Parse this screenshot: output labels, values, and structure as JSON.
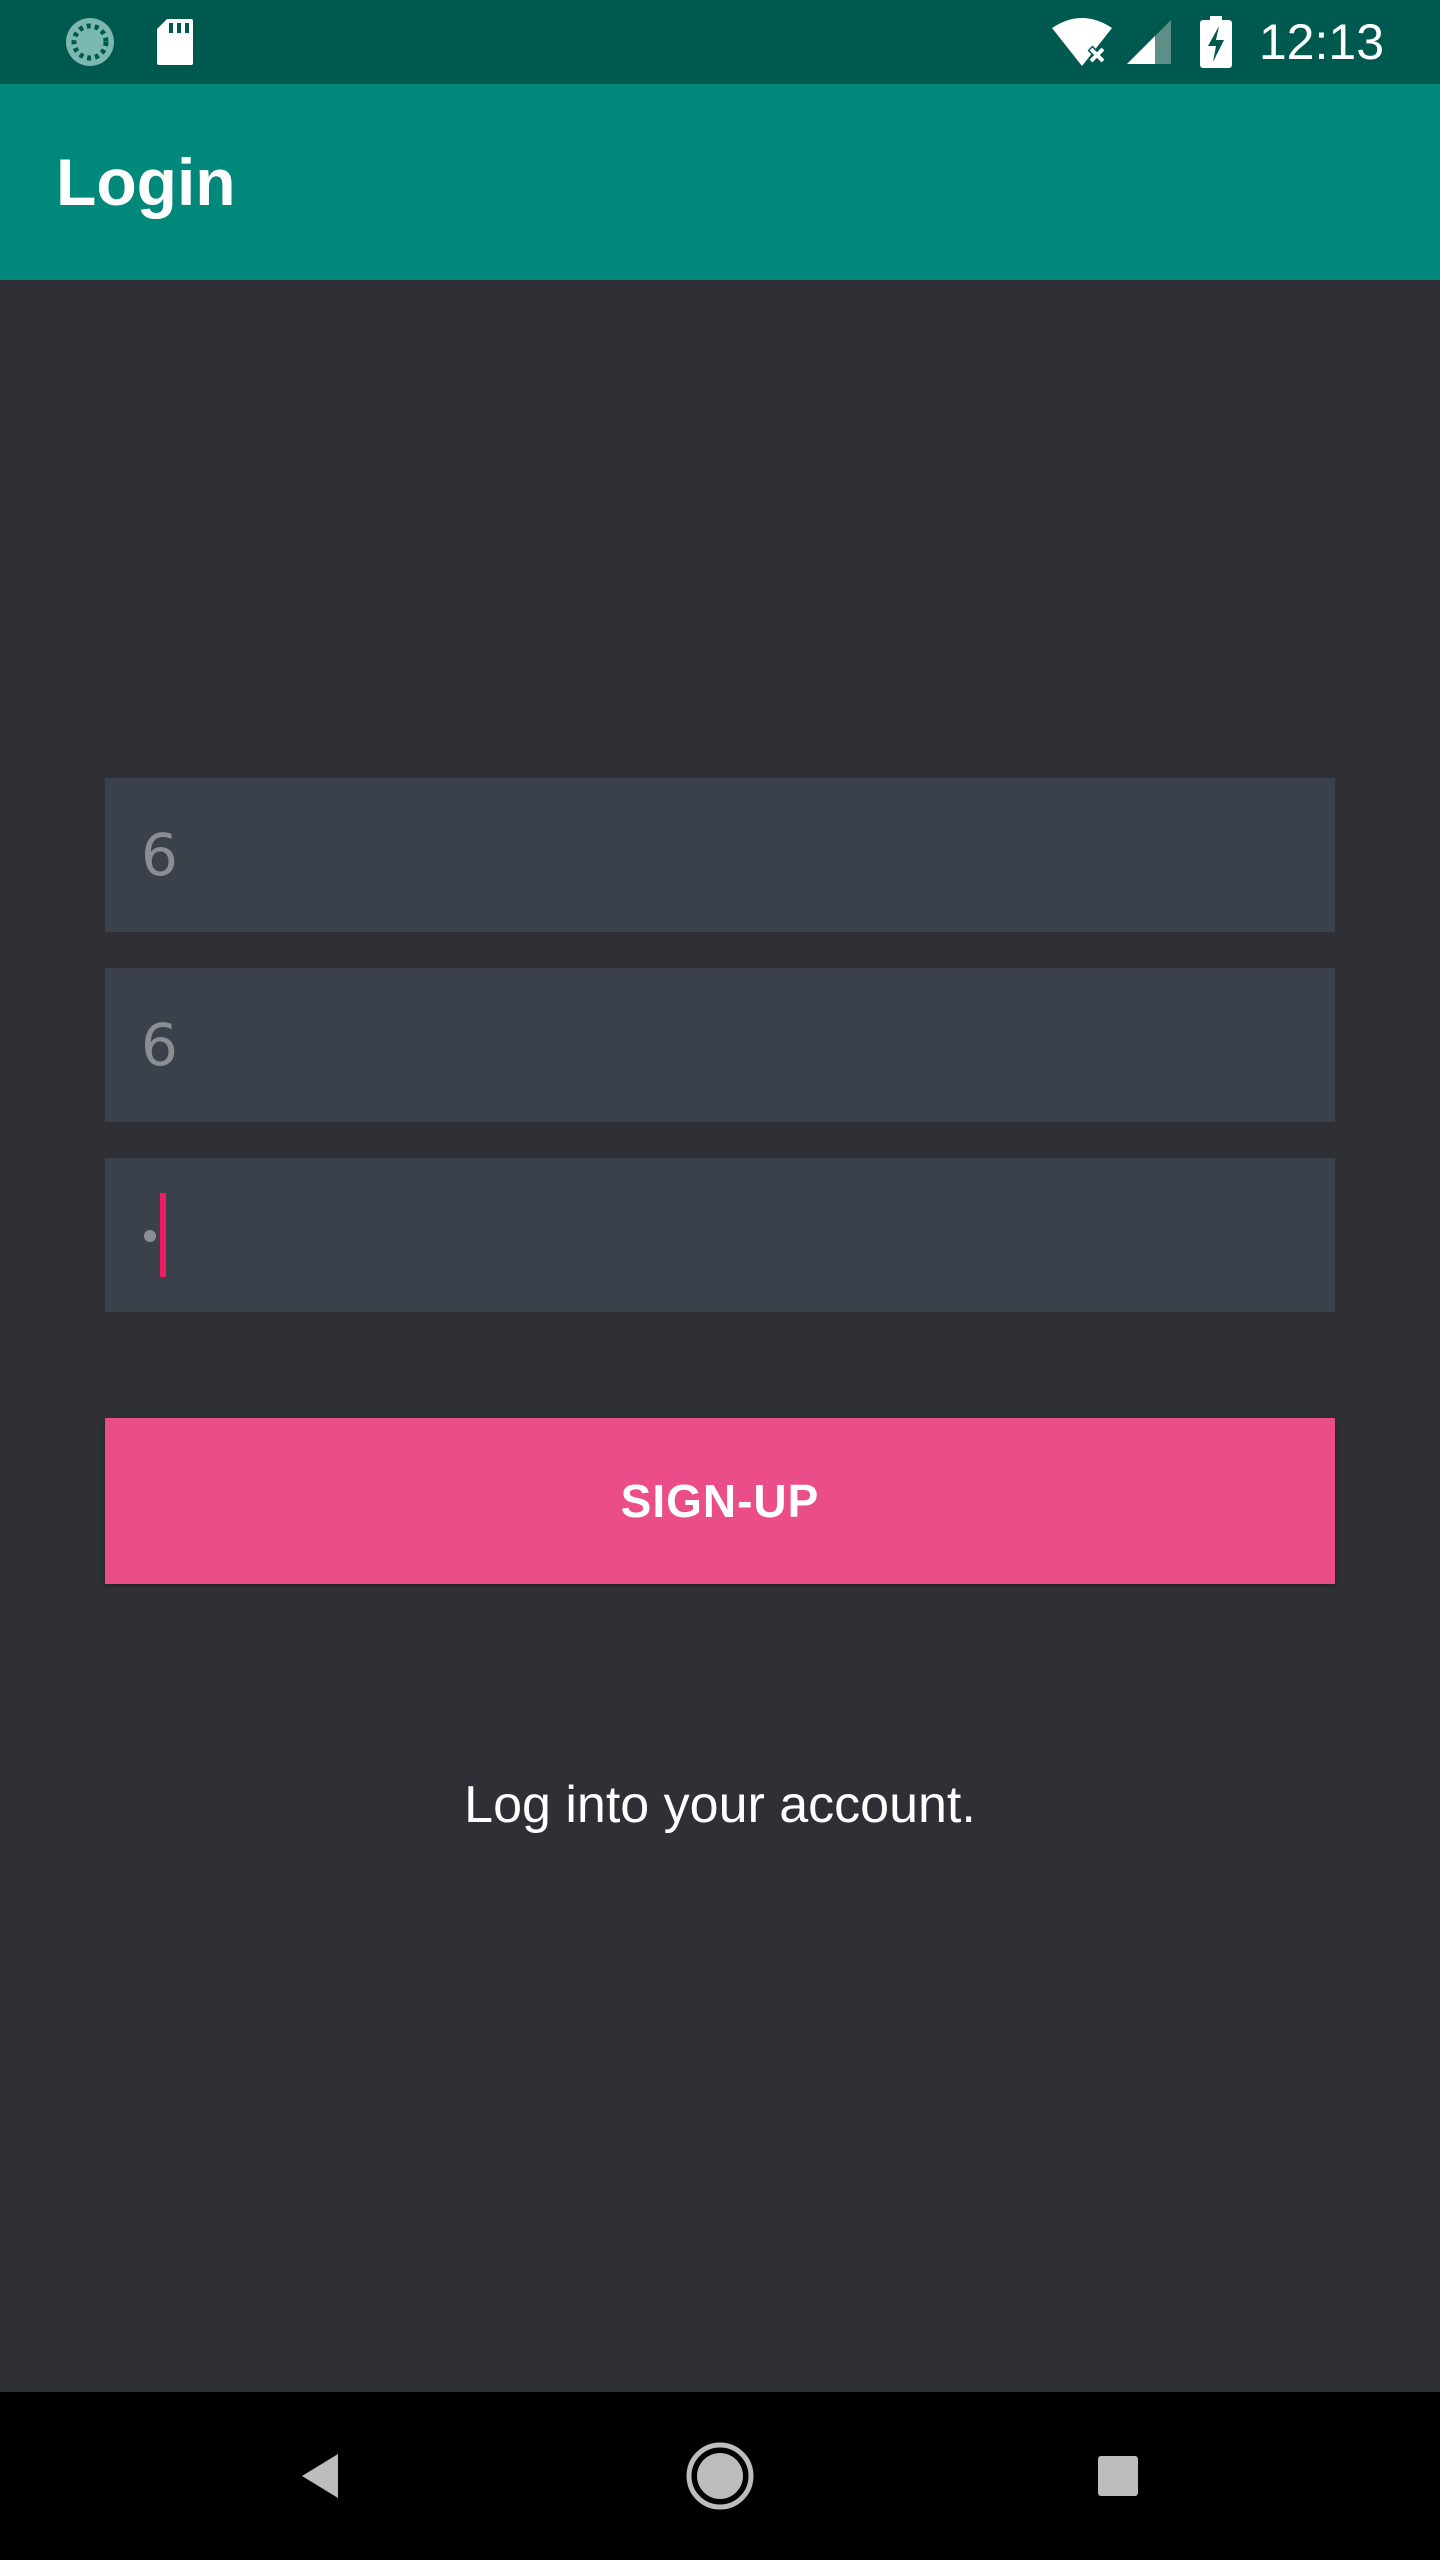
{
  "status_bar": {
    "time": "12:13",
    "icons": [
      "sync-icon",
      "sd-card-icon",
      "wifi-off-icon",
      "signal-icon",
      "battery-charging-icon"
    ]
  },
  "app_bar": {
    "title": "Login"
  },
  "form": {
    "field1_value": "6",
    "field2_value": "6",
    "field3_value": ""
  },
  "signup_button": {
    "label": "SIGN-UP"
  },
  "login_link": {
    "text": "Log into your account."
  },
  "nav_bar": {
    "icons": [
      "back-icon",
      "home-icon",
      "recents-icon"
    ]
  },
  "colors": {
    "status_bar": "#00594f",
    "app_bar": "#00887a",
    "background": "#2e3035",
    "field": "#3b414a",
    "accent": "#eb4d89",
    "cursor": "#e91e63"
  }
}
